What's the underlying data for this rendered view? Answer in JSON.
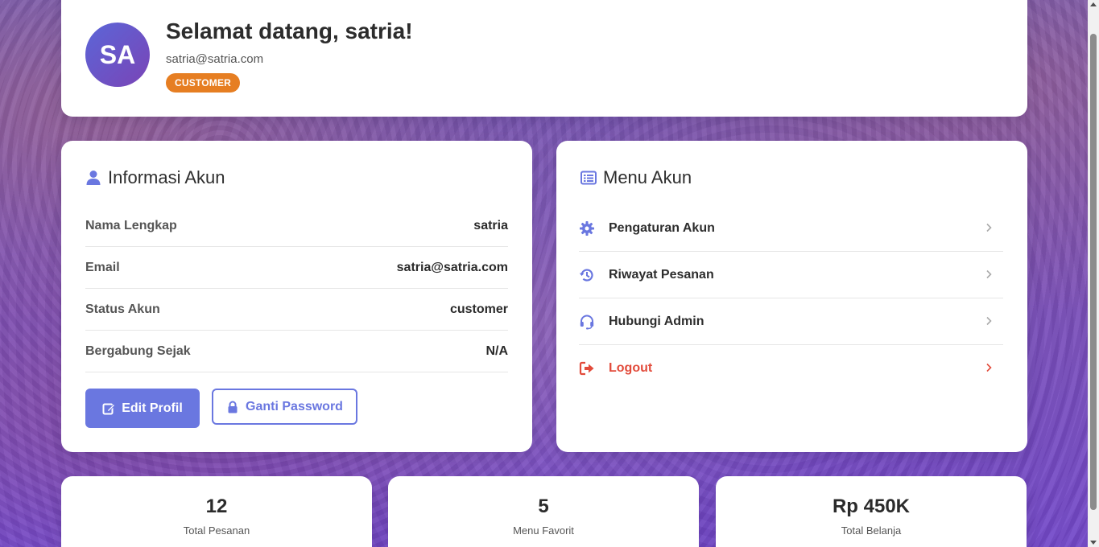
{
  "header": {
    "avatar_initials": "SA",
    "welcome": "Selamat datang, satria!",
    "email": "satria@satria.com",
    "role_badge": "CUSTOMER"
  },
  "info": {
    "title": "Informasi Akun",
    "rows": [
      {
        "label": "Nama Lengkap",
        "value": "satria"
      },
      {
        "label": "Email",
        "value": "satria@satria.com"
      },
      {
        "label": "Status Akun",
        "value": "customer"
      },
      {
        "label": "Bergabung Sejak",
        "value": "N/A"
      }
    ],
    "edit_button": "Edit Profil",
    "password_button": "Ganti Password"
  },
  "menu": {
    "title": "Menu Akun",
    "items": [
      {
        "label": "Pengaturan Akun",
        "icon": "gear-icon"
      },
      {
        "label": "Riwayat Pesanan",
        "icon": "history-icon"
      },
      {
        "label": "Hubungi Admin",
        "icon": "headset-icon"
      },
      {
        "label": "Logout",
        "icon": "logout-icon"
      }
    ]
  },
  "stats": [
    {
      "value": "12",
      "label": "Total Pesanan"
    },
    {
      "value": "5",
      "label": "Menu Favorit"
    },
    {
      "value": "Rp 450K",
      "label": "Total Belanja"
    }
  ],
  "colors": {
    "accent": "#6a77e0",
    "badge": "#e67e22",
    "logout": "#e24b3b"
  }
}
